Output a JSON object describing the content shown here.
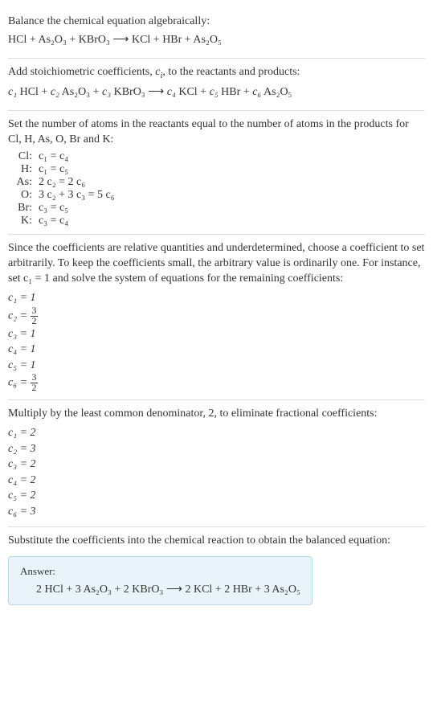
{
  "intro": {
    "line1": "Balance the chemical equation algebraically:",
    "eq": "HCl + As₂O₃ + KBrO₃  ⟶  KCl + HBr + As₂O₅"
  },
  "stoich": {
    "line1_pre": "Add stoichiometric coefficients, ",
    "line1_mid": "c",
    "line1_sub": "i",
    "line1_post": ", to the reactants and products:",
    "eq_c1": "c₁",
    "eq_r1": " HCl + ",
    "eq_c2": "c₂",
    "eq_r2": " As₂O₃ + ",
    "eq_c3": "c₃",
    "eq_r3": " KBrO₃  ⟶  ",
    "eq_c4": "c₄",
    "eq_r4": " KCl + ",
    "eq_c5": "c₅",
    "eq_r5": " HBr + ",
    "eq_c6": "c₆",
    "eq_r6": " As₂O₅"
  },
  "atoms": {
    "intro": "Set the number of atoms in the reactants equal to the number of atoms in the products for Cl, H, As, O, Br and K:",
    "rows": [
      {
        "el": "Cl:",
        "eq": "c₁ = c₄"
      },
      {
        "el": "H:",
        "eq": "c₁ = c₅"
      },
      {
        "el": "As:",
        "eq": "2 c₂ = 2 c₆"
      },
      {
        "el": "O:",
        "eq": "3 c₂ + 3 c₃ = 5 c₆"
      },
      {
        "el": "Br:",
        "eq": "c₃ = c₅"
      },
      {
        "el": "K:",
        "eq": "c₃ = c₄"
      }
    ]
  },
  "solve1": {
    "text": "Since the coefficients are relative quantities and underdetermined, choose a coefficient to set arbitrarily. To keep the coefficients small, the arbitrary value is ordinarily one. For instance, set c₁ = 1 and solve the system of equations for the remaining coefficients:",
    "c1": "c₁ = 1",
    "c2_lhs": "c₂ = ",
    "c2_num": "3",
    "c2_den": "2",
    "c3": "c₃ = 1",
    "c4": "c₄ = 1",
    "c5": "c₅ = 1",
    "c6_lhs": "c₆ = ",
    "c6_num": "3",
    "c6_den": "2"
  },
  "solve2": {
    "text": "Multiply by the least common denominator, 2, to eliminate fractional coefficients:",
    "rows": [
      "c₁ = 2",
      "c₂ = 3",
      "c₃ = 2",
      "c₄ = 2",
      "c₅ = 2",
      "c₆ = 3"
    ]
  },
  "final": {
    "text": "Substitute the coefficients into the chemical reaction to obtain the balanced equation:",
    "answer_label": "Answer:",
    "answer_eq": "2 HCl + 3 As₂O₃ + 2 KBrO₃  ⟶  2 KCl + 2 HBr + 3 As₂O₅"
  }
}
